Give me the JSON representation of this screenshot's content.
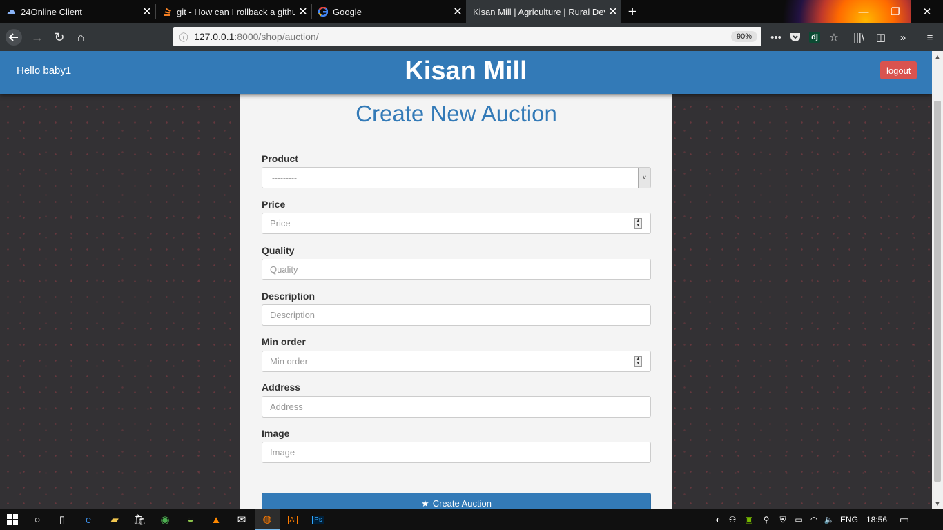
{
  "browser": {
    "tabs": [
      {
        "title": "24Online Client",
        "icon": "cloud-icon"
      },
      {
        "title": "git - How can I rollback a githu",
        "icon": "stackoverflow-icon"
      },
      {
        "title": "Google",
        "icon": "google-icon"
      },
      {
        "title": "Kisan Mill | Agriculture | Rural Deve",
        "icon": "none",
        "active": true
      }
    ],
    "url_host": "127.0.0.1",
    "url_rest": ":8000/shop/auction/",
    "zoom": "90%",
    "extension_label": "dj"
  },
  "header": {
    "greeting": "Hello baby1",
    "brand": "Kisan Mill",
    "logout_label": "logout"
  },
  "form": {
    "title": "Create New Auction",
    "product": {
      "label": "Product",
      "value": "---------"
    },
    "price": {
      "label": "Price",
      "placeholder": "Price"
    },
    "quality": {
      "label": "Quality",
      "placeholder": "Quality"
    },
    "description": {
      "label": "Description",
      "placeholder": "Description"
    },
    "min_order": {
      "label": "Min order",
      "placeholder": "Min order"
    },
    "address": {
      "label": "Address",
      "placeholder": "Address"
    },
    "image": {
      "label": "Image",
      "placeholder": "Image"
    },
    "submit_label": "Create Auction"
  },
  "taskbar": {
    "language": "ENG",
    "time": "18:56",
    "apps": [
      "start",
      "search",
      "task-view",
      "edge",
      "file-explorer",
      "store",
      "chrome",
      "vpn",
      "vlc",
      "mail",
      "firefox",
      "illustrator",
      "photoshop"
    ],
    "ai_label": "Ai",
    "ps_label": "Ps"
  },
  "colors": {
    "primary": "#337ab7",
    "danger": "#d9534f",
    "page_bg": "#333134"
  }
}
